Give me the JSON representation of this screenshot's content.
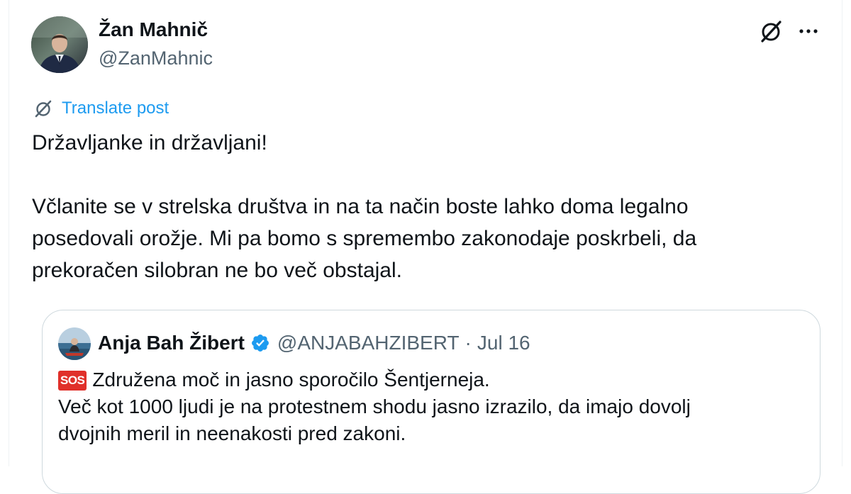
{
  "author": {
    "display_name": "Žan Mahnič",
    "handle": "@ZanMahnic",
    "avatar_icon": "profile-photo"
  },
  "header_actions": {
    "grok_icon": "slashed-circle-icon",
    "more_label": "···"
  },
  "translate": {
    "icon": "slashed-circle-icon",
    "label": "Translate post"
  },
  "post": {
    "line1": "Državljanke in državljani!",
    "paragraph2_line1": "Včlanite se v strelska društva in na ta način boste lahko doma legalno",
    "paragraph2_line2": "posedovali orožje. Mi pa bomo s spremembo zakonodaje poskrbeli, da",
    "paragraph2_line3": "prekoračen silobran ne bo več obstajal."
  },
  "quoted_post": {
    "display_name": "Anja Bah Žibert",
    "verified_icon": "verified-badge-icon",
    "handle": "@ANJABAHZIBERT",
    "separator": "·",
    "date": "Jul 16",
    "badge_text": "SOS",
    "line1": "Združena moč in jasno sporočilo Šentjerneja.",
    "line2": "Več kot 1000 ljudi je na protestnem shodu jasno izrazilo, da imajo dovolj",
    "line3": "dvojnih meril in neenakosti pred zakoni."
  },
  "colors": {
    "link_blue": "#1d9bf0",
    "secondary_text": "#536471",
    "border": "#cfd9de",
    "sos_red": "#e0302a"
  }
}
